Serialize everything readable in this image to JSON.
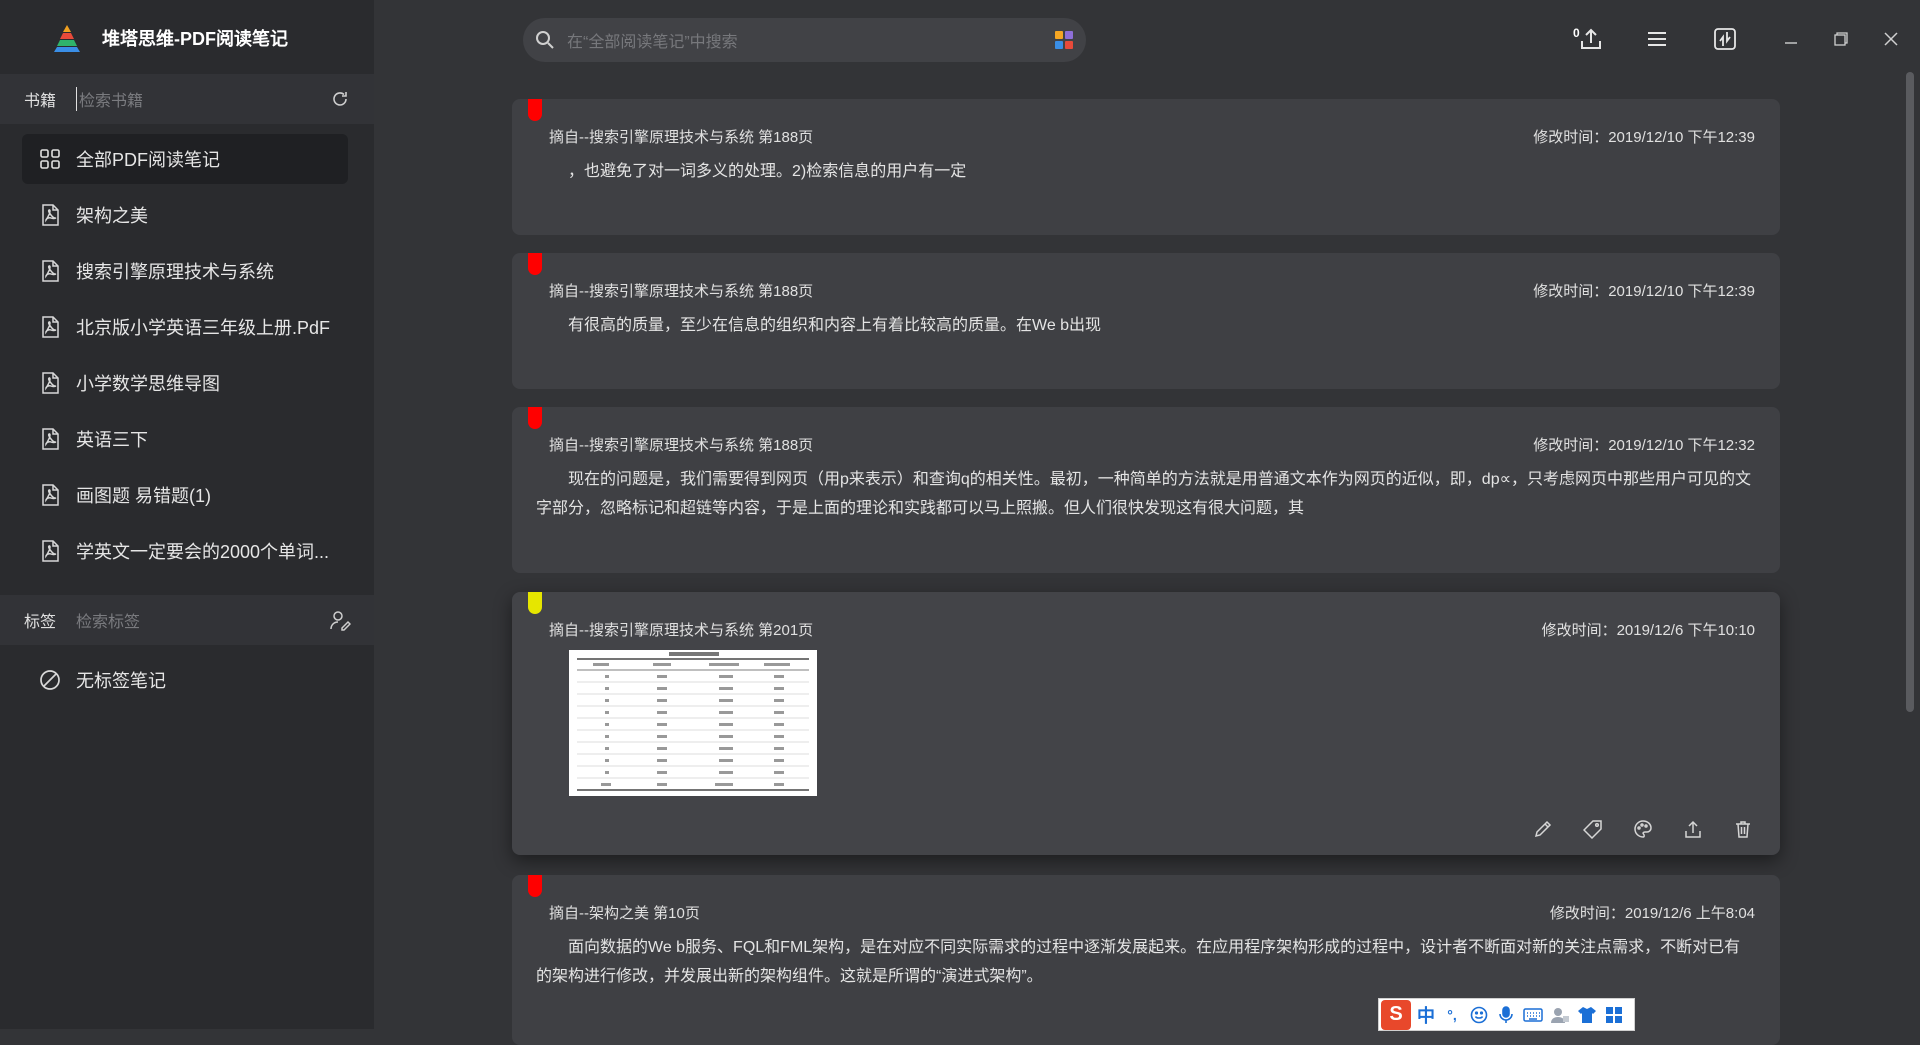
{
  "app": {
    "title": "堆塔思维-PDF阅读笔记"
  },
  "books": {
    "label": "书籍",
    "search_placeholder": "检索书籍",
    "items": [
      {
        "label": "全部PDF阅读笔记",
        "icon": "grid-icon",
        "active": true
      },
      {
        "label": "架构之美",
        "icon": "pdf-icon"
      },
      {
        "label": "搜索引擎原理技术与系统",
        "icon": "pdf-icon"
      },
      {
        "label": "北京版小学英语三年级上册.PdF",
        "icon": "pdf-icon"
      },
      {
        "label": "小学数学思维导图",
        "icon": "pdf-icon"
      },
      {
        "label": "英语三下",
        "icon": "pdf-icon"
      },
      {
        "label": "画图题 易错题(1)",
        "icon": "pdf-icon"
      },
      {
        "label": "学英文一定要会的2000个单词...",
        "icon": "pdf-icon"
      }
    ]
  },
  "tags": {
    "label": "标签",
    "search_placeholder": "检索标签",
    "items": [
      {
        "label": "无标签笔记",
        "icon": "no-tag-icon"
      }
    ]
  },
  "search": {
    "placeholder": "在“全部阅读笔记”中搜索"
  },
  "toolbar": {
    "export_count": "0"
  },
  "notes": [
    {
      "source": "摘自--搜索引擎原理技术与系统 第188页",
      "time": "修改时间：2019/12/10 下午12:39",
      "text": "，也避免了对一词多义的处理。2)检索信息的用户有一定",
      "flag_color": "#ff0000"
    },
    {
      "source": "摘自--搜索引擎原理技术与系统 第188页",
      "time": "修改时间：2019/12/10 下午12:39",
      "text": "有很高的质量，至少在信息的组织和内容上有着比较高的质量。在We b出现",
      "flag_color": "#ff0000"
    },
    {
      "source": "摘自--搜索引擎原理技术与系统 第188页",
      "time": "修改时间：2019/12/10 下午12:32",
      "text": "现在的问题是，我们需要得到网页（用p来表示）和查询q的相关性。最初，一种简单的方法就是用普通文本作为网页的近似，即，dp∝，只考虑网页中那些用户可见的文字部分，忽略标记和超链等内容，于是上面的理论和实践都可以马上照搬。但人们很快发现这有很大问题，其",
      "flag_color": "#ff0000"
    },
    {
      "source": "摘自--搜索引擎原理技术与系统 第201页",
      "time": "修改时间：2019/12/6 下午10:10",
      "image": "table-screenshot",
      "flag_color": "#e6e600"
    },
    {
      "source": "摘自--架构之美 第10页",
      "time": "修改时间：2019/12/6 上午8:04",
      "text": "面向数据的We b服务、FQL和FML架构，是在对应不同实际需求的过程中逐渐发展起来。在应用程序架构形成的过程中，设计者不断面对新的关注点需求，不断对已有的架构进行修改，并发展出新的架构组件。这就是所谓的“演进式架构”。",
      "flag_color": "#ff0000"
    }
  ],
  "ime": {
    "lang": "中",
    "punct": "°,"
  },
  "colors": {
    "accent_red": "#ff0000",
    "accent_yellow": "#e6e600",
    "sidebar": "#2a2b2e",
    "main": "#333437",
    "card": "#3f4044"
  }
}
